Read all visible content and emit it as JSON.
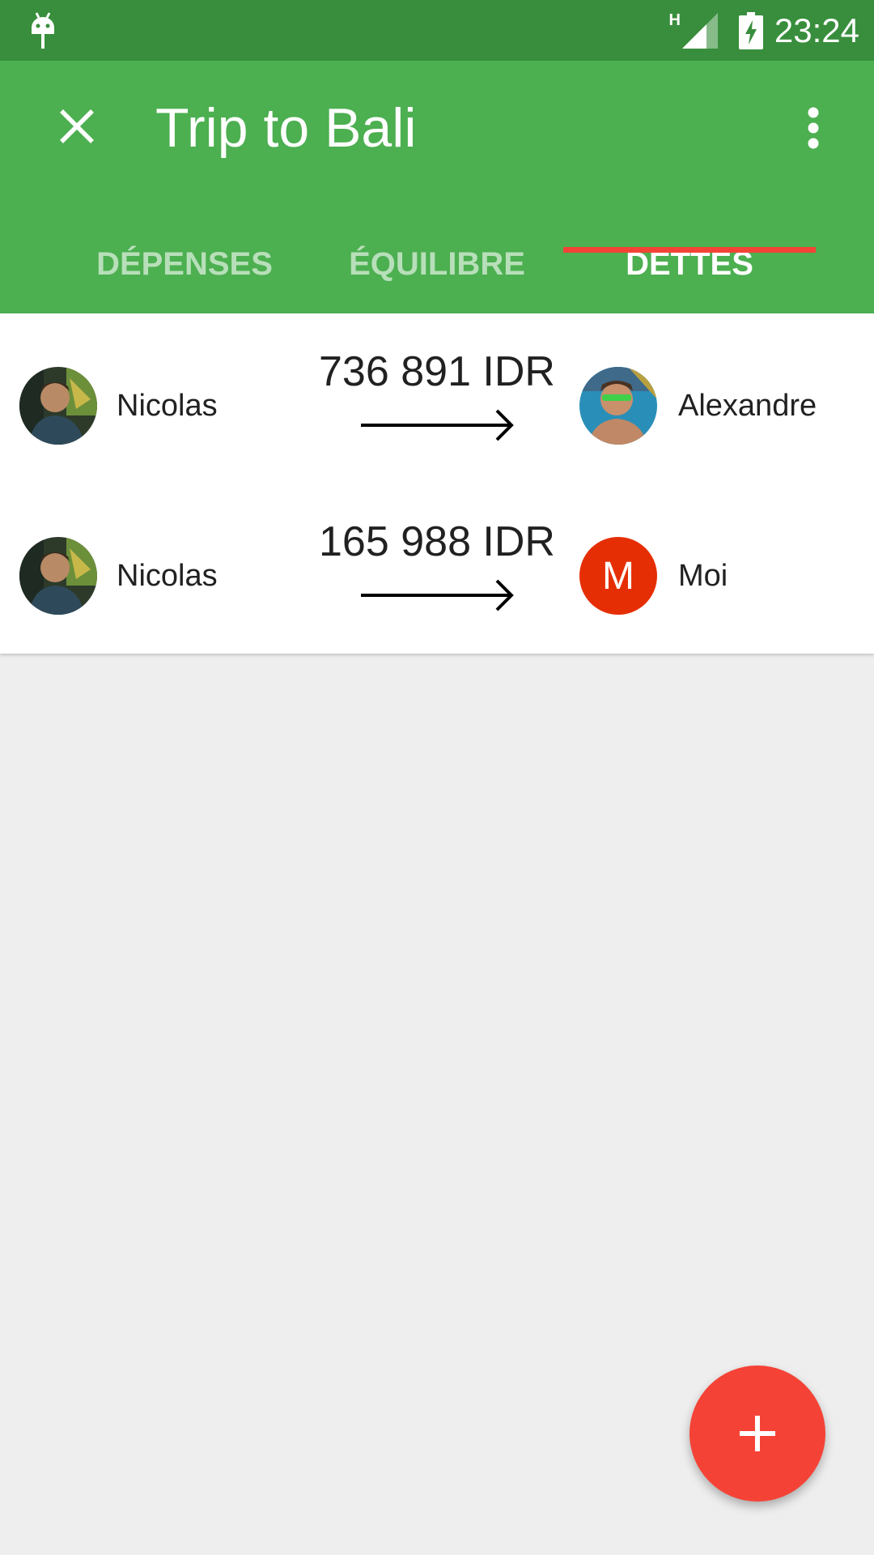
{
  "status_bar": {
    "network_type": "H",
    "time": "23:24",
    "icons": [
      "android-debug-icon",
      "signal-icon",
      "battery-charging-icon"
    ]
  },
  "app_bar": {
    "title": "Trip to Bali",
    "close_icon": "close-icon",
    "menu_icon": "more-vert-icon"
  },
  "tabs": [
    {
      "label": "DÉPENSES",
      "active": false
    },
    {
      "label": "ÉQUILIBRE",
      "active": false
    },
    {
      "label": "DETTES",
      "active": true
    }
  ],
  "debts": [
    {
      "from": "Nicolas",
      "amount": "736 891 IDR",
      "to": "Alexandre",
      "to_avatar": "photo"
    },
    {
      "from": "Nicolas",
      "amount": "165 988 IDR",
      "to": "Moi",
      "to_avatar_letter": "M"
    }
  ],
  "fab": {
    "icon": "add-icon"
  },
  "colors": {
    "primary": "#4caf50",
    "primary_dark": "#388e3c",
    "accent": "#f44336",
    "avatar_letter_bg": "#e62e04",
    "background": "#eeeeee"
  }
}
